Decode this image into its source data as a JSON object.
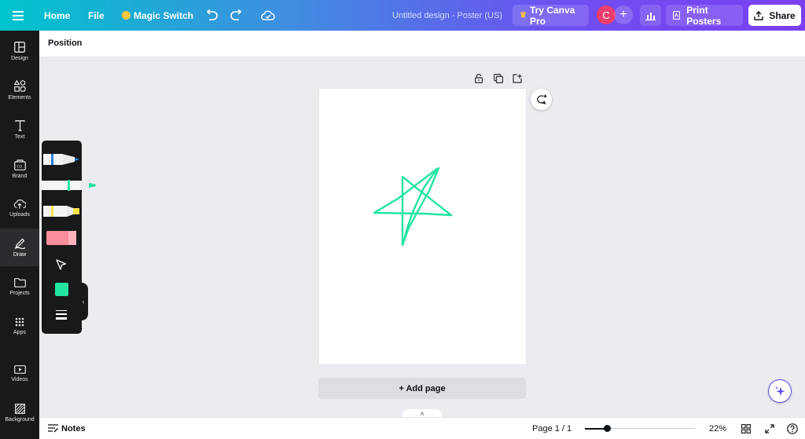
{
  "topbar": {
    "home": "Home",
    "file": "File",
    "magic_switch": "Magic Switch",
    "design_title": "Untitled design - Poster (US)",
    "try_pro": "Try Canva Pro",
    "avatar_initial": "C",
    "print": "Print Posters",
    "share": "Share"
  },
  "sidebar": {
    "items": [
      {
        "label": "Design",
        "icon": "layout-icon"
      },
      {
        "label": "Elements",
        "icon": "shapes-icon"
      },
      {
        "label": "Text",
        "icon": "text-icon"
      },
      {
        "label": "Brand",
        "icon": "brand-icon"
      },
      {
        "label": "Uploads",
        "icon": "cloud-upload-icon"
      },
      {
        "label": "Draw",
        "icon": "draw-icon"
      },
      {
        "label": "Projects",
        "icon": "folder-icon"
      },
      {
        "label": "Apps",
        "icon": "apps-icon"
      },
      {
        "label": "Videos",
        "icon": "video-icon"
      },
      {
        "label": "Background",
        "icon": "background-icon"
      }
    ],
    "active": "Draw"
  },
  "toolbar": {
    "position": "Position"
  },
  "draw_panel": {
    "active_color": "#23e4a0",
    "tools": [
      "pen",
      "marker",
      "highlighter",
      "eraser",
      "select"
    ]
  },
  "canvas": {
    "stroke_color": "#23e4a0"
  },
  "add_page": "+ Add page",
  "bottom": {
    "notes": "Notes",
    "page": "Page 1 / 1",
    "zoom": "22%",
    "zoom_level": 0.2
  },
  "colors": {
    "brand_gradient_start": "#00c4cc",
    "brand_gradient_end": "#7b3ff2",
    "accent": "#8b3dff"
  }
}
